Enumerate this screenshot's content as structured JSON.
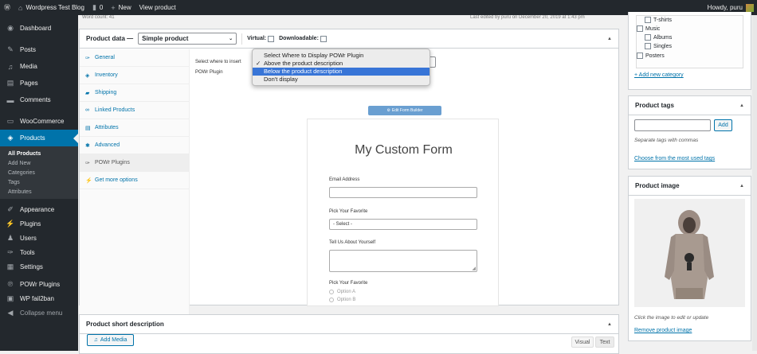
{
  "adminbar": {
    "site": "Wordpress Test Blog",
    "comments": "0",
    "new": "New",
    "view": "View product",
    "howdy": "Howdy, puru"
  },
  "sidebar": {
    "items": [
      {
        "label": "Dashboard",
        "icon": "dashboard-icon"
      },
      {
        "label": "Posts",
        "icon": "pin-icon"
      },
      {
        "label": "Media",
        "icon": "media-icon"
      },
      {
        "label": "Pages",
        "icon": "pages-icon"
      },
      {
        "label": "Comments",
        "icon": "comment-icon"
      },
      {
        "label": "WooCommerce",
        "icon": "woo-icon"
      },
      {
        "label": "Products",
        "icon": "products-icon"
      }
    ],
    "sub": [
      "All Products",
      "Add New",
      "Categories",
      "Tags",
      "Attributes"
    ],
    "items2": [
      {
        "label": "Appearance"
      },
      {
        "label": "Plugins"
      },
      {
        "label": "Users"
      },
      {
        "label": "Tools"
      },
      {
        "label": "Settings"
      },
      {
        "label": "POWr Plugins"
      },
      {
        "label": "WP fail2ban"
      },
      {
        "label": "Collapse menu"
      }
    ]
  },
  "top_strip": {
    "word_count": "Word count: 41",
    "last_edited": "Last edited by puru on December 20, 2019 at 1:43 pm"
  },
  "product_data": {
    "title": "Product data —",
    "type_selected": "Simple product",
    "virtual": "Virtual:",
    "downloadable": "Downloadable:",
    "tabs": [
      "General",
      "Inventory",
      "Shipping",
      "Linked Products",
      "Attributes",
      "Advanced",
      "POWr Plugins",
      "Get more options"
    ],
    "select_label": "Select where to insert",
    "plugin_label": "POWr Plugin",
    "dropdown": [
      "Select Where to Display POWr Plugin",
      "Above the product description",
      "Below the product description",
      "Don't display"
    ],
    "checked_index": 1,
    "highlight_index": 2,
    "edit_form_builder": "Edit Form Builder",
    "form": {
      "title": "My Custom Form",
      "email": "Email Address",
      "pick1": "Pick Your Favorite",
      "select_placeholder": "- Select -",
      "about": "Tell Us About Yourself",
      "pick2": "Pick Your Favorite",
      "opt_a": "Option A",
      "opt_b": "Option B"
    }
  },
  "short_desc": {
    "title": "Product short description",
    "add_media": "Add Media",
    "visual": "Visual",
    "text": "Text"
  },
  "categories": {
    "items": [
      "T-shirts",
      "Music",
      "Albums",
      "Singles",
      "Posters"
    ],
    "add": "+ Add new category"
  },
  "tags": {
    "title": "Product tags",
    "add": "Add",
    "hint": "Separate tags with commas",
    "choose": "Choose from the most used tags"
  },
  "image": {
    "title": "Product image",
    "hint": "Click the image to edit or update",
    "remove": "Remove product image"
  },
  "colors": {
    "accent": "#0073aa",
    "sidebar": "#23282d",
    "highlight": "#3875d7"
  }
}
